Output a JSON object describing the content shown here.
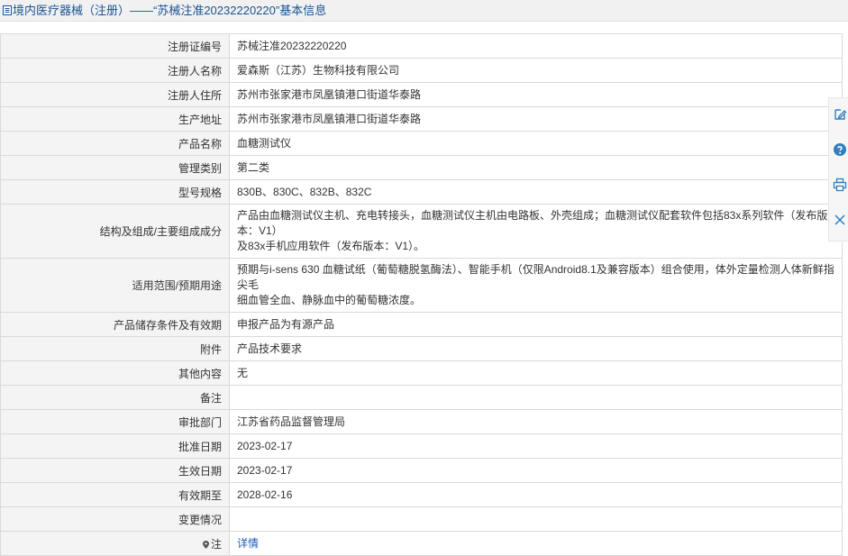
{
  "header": {
    "title": "境内医疗器械（注册）——“苏械注准20232220220”基本信息"
  },
  "rows": [
    {
      "label": "注册证编号",
      "value": "苏械注准20232220220"
    },
    {
      "label": "注册人名称",
      "value": "爱森斯（江苏）生物科技有限公司"
    },
    {
      "label": "注册人住所",
      "value": "苏州市张家港市凤凰镇港口街道华泰路"
    },
    {
      "label": "生产地址",
      "value": "苏州市张家港市凤凰镇港口街道华泰路"
    },
    {
      "label": "产品名称",
      "value": "血糖测试仪"
    },
    {
      "label": "管理类别",
      "value": "第二类"
    },
    {
      "label": "型号规格",
      "value": "830B、830C、832B、832C"
    },
    {
      "label": "结构及组成/主要组成成分",
      "value_line1": "产品由血糖测试仪主机、充电转接头，血糖测试仪主机由电路板、外壳组成；血糖测试仪配套软件包括83x系列软件（发布版本：V1）",
      "value_line2": "及83x手机应用软件（发布版本：V1）。"
    },
    {
      "label": "适用范围/预期用途",
      "value_line1": "预期与i-sens 630 血糖试纸（葡萄糖脱氢酶法）、智能手机（仅限Android8.1及兼容版本）组合使用，体外定量检测人体新鲜指尖毛",
      "value_line2": "细血管全血、静脉血中的葡萄糖浓度。"
    },
    {
      "label": "产品储存条件及有效期",
      "value": "申报产品为有源产品"
    },
    {
      "label": "附件",
      "value": "产品技术要求"
    },
    {
      "label": "其他内容",
      "value": "无"
    },
    {
      "label": "备注",
      "value": ""
    },
    {
      "label": "审批部门",
      "value": "江苏省药品监督管理局"
    },
    {
      "label": "批准日期",
      "value": "2023-02-17"
    },
    {
      "label": "生效日期",
      "value": "2023-02-17"
    },
    {
      "label": "有效期至",
      "value": "2028-02-16"
    },
    {
      "label": "变更情况",
      "value": ""
    },
    {
      "label": "注",
      "value": "详情"
    }
  ],
  "sidebar": {
    "icons": [
      "edit-icon",
      "help-icon",
      "print-icon",
      "close-icon"
    ]
  },
  "colors": {
    "header_text": "#1a5291",
    "link": "#1a5bb5",
    "sidebar_icon": "#2f7fc1",
    "label_bg": "#f4f4f4",
    "border": "#d9d9d9"
  }
}
